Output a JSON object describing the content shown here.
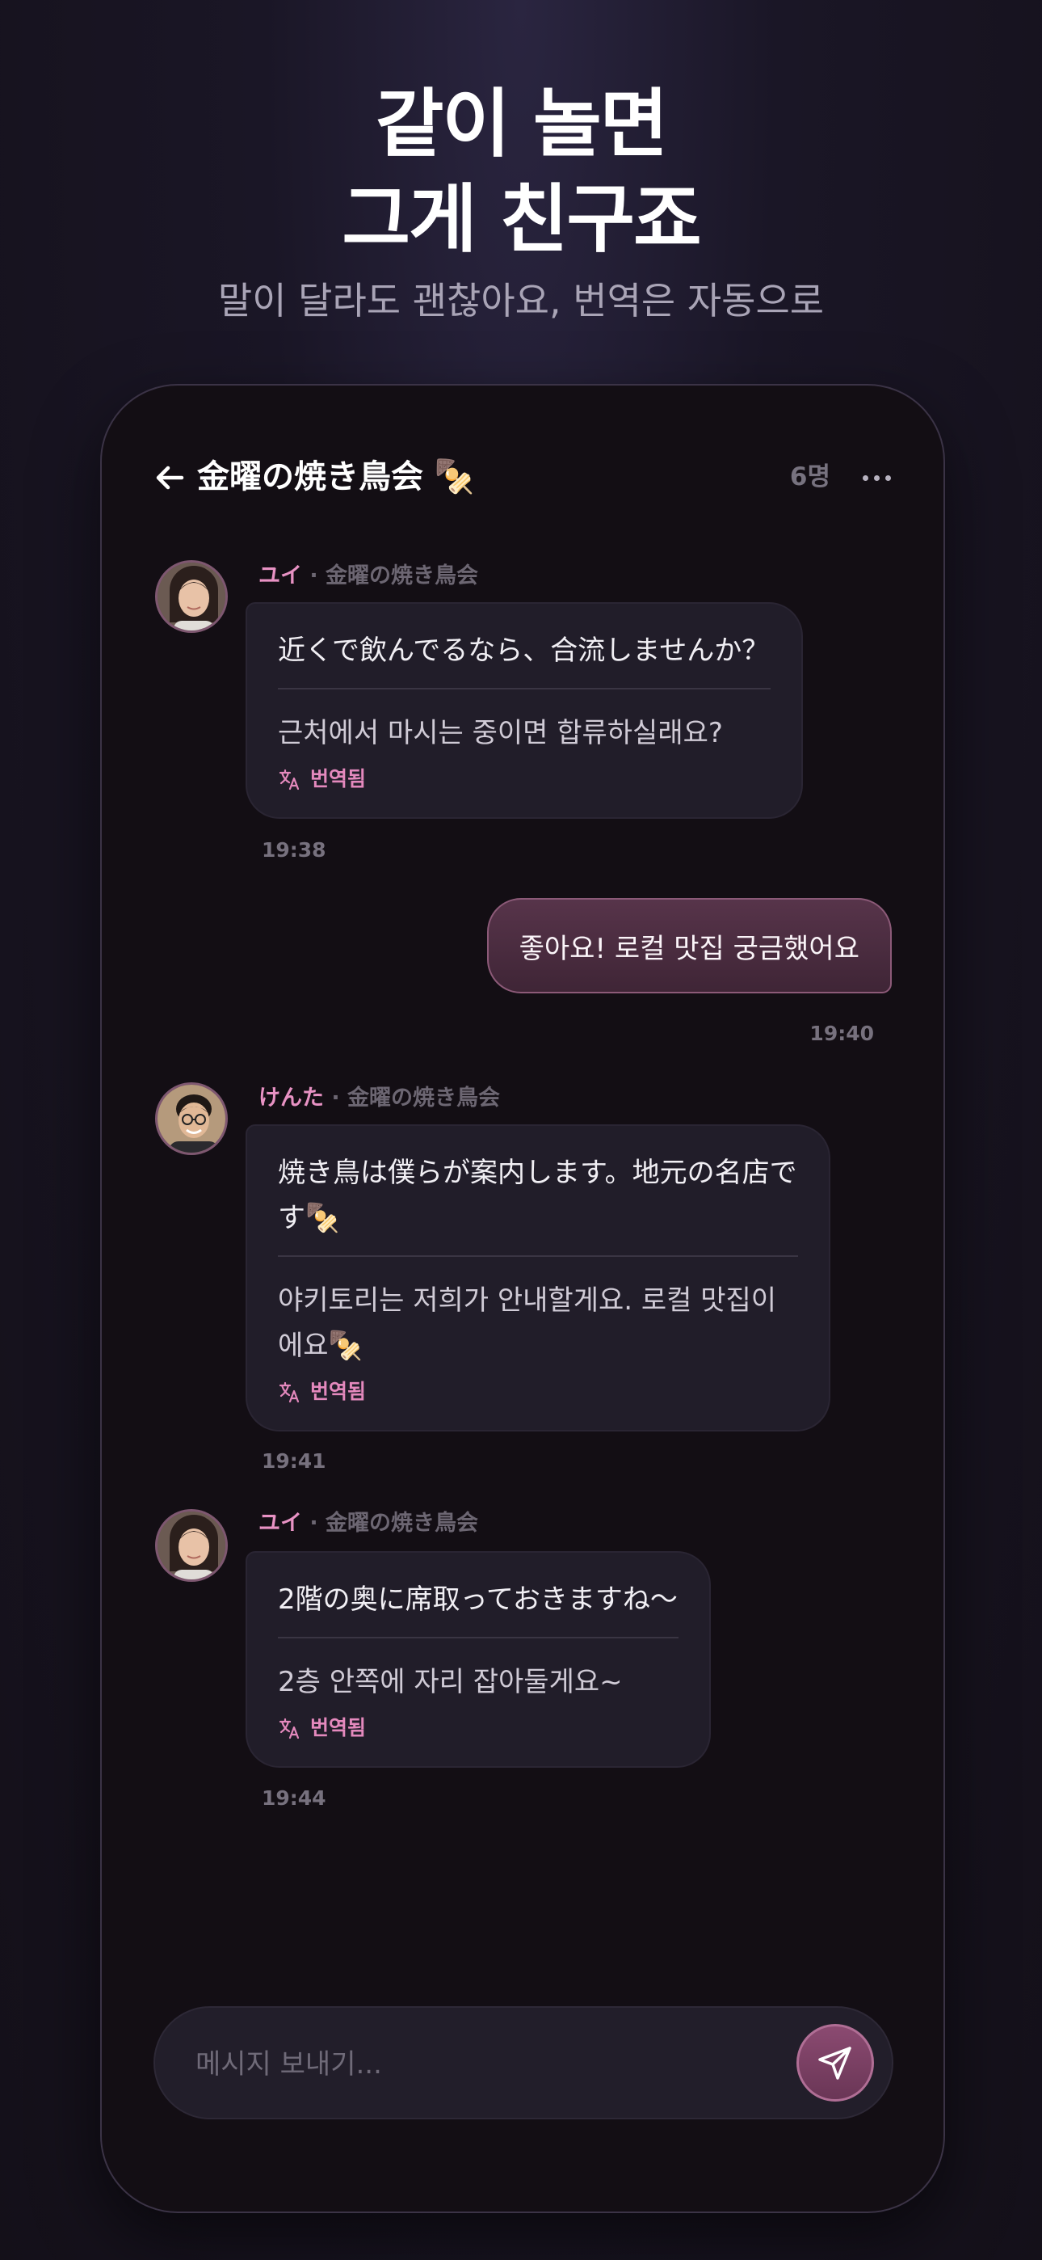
{
  "hero": {
    "title_line1": "같이 놀면",
    "title_line2": "그게 친구죠",
    "subtitle": "말이 달라도 괜찮아요, 번역은 자동으로"
  },
  "chat": {
    "title": "金曜の焼き鳥会 🍢",
    "member_count": "6명",
    "messages": [
      {
        "sender": "ユイ",
        "group": " · 金曜の焼き鳥会",
        "original": "近くで飲んでるなら、合流しませんか？",
        "translated": "근처에서 마시는 중이면 합류하실래요?",
        "tag": "번역됨",
        "time": "19:38"
      },
      {
        "outgoing": true,
        "text": "좋아요! 로컬 맛집 궁금했어요",
        "time": "19:40"
      },
      {
        "sender": "けんた",
        "group": " · 金曜の焼き鳥会",
        "original": "焼き鳥は僕らが案内します。地元の名店です🍢",
        "translated": "야키토리는 저희가 안내할게요. 로컬 맛집이에요🍢",
        "tag": "번역됨",
        "time": "19:41"
      },
      {
        "sender": "ユイ",
        "group": " · 金曜の焼き鳥会",
        "original": "2階の奥に席取っておきますね〜",
        "translated": "2층 안쪽에 자리 잡아둘게요~",
        "tag": "번역됨",
        "time": "19:44"
      }
    ]
  },
  "composer": {
    "placeholder": "메시지 보내기..."
  },
  "colors": {
    "accent": "#e489bd",
    "bubble_out": "#4a2c40",
    "bubble_in": "#211d29",
    "background": "#141019"
  }
}
